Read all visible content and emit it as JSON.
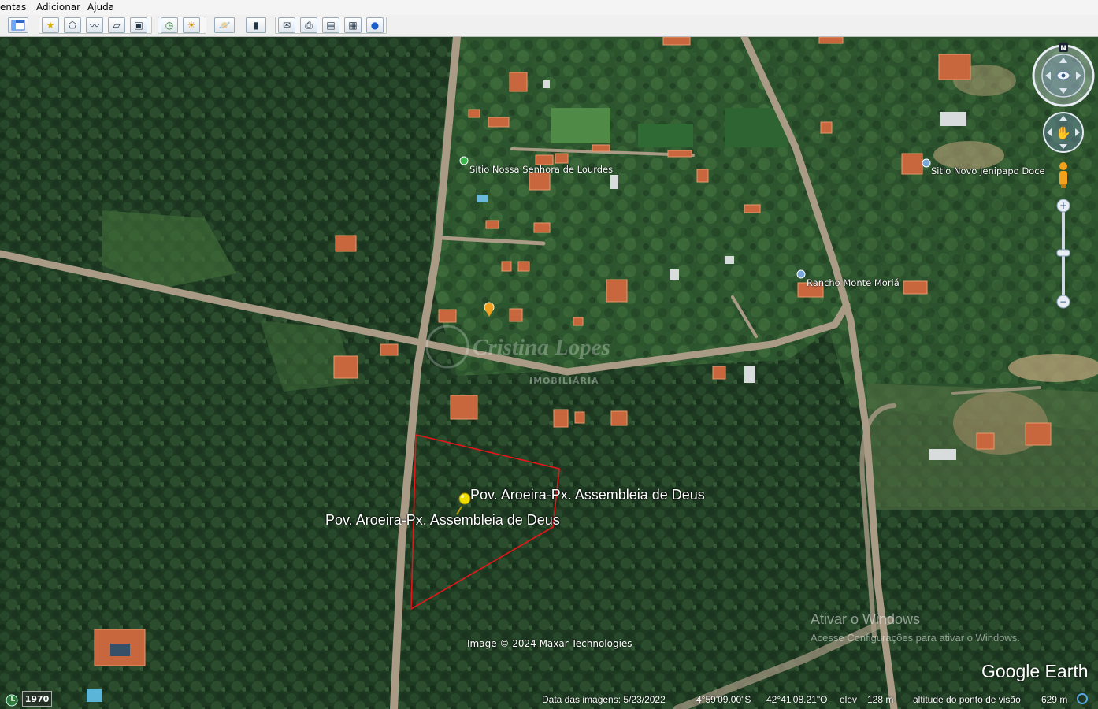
{
  "menu": [
    {
      "label": "entas"
    },
    {
      "label": "Adicionar"
    },
    {
      "label": "Ajuda"
    }
  ],
  "places": [
    {
      "name": "Sítio Nossa Senhora de Lourdes"
    },
    {
      "name": "Sitio Novo Jenipapo Doce"
    },
    {
      "name": "Rancho Monte Moriá"
    }
  ],
  "placemark": {
    "label": "Pov. Aroeira-Px. Assembleia de Deus",
    "polygon_label": "Pov. Aroeira-Px. Assembleia de Deus",
    "color": "#f0e000",
    "outline_color": "#e8141a"
  },
  "watermark": {
    "title": "Cristina Lopes",
    "subtitle": "IMOBILIÁRIA"
  },
  "credit": "Image © 2024 Maxar Technologies",
  "windows_activation": {
    "line1": "Ativar o Windows",
    "line2": "Acesse Configurações para ativar o Windows."
  },
  "logo": "Google Earth",
  "status": {
    "year": "1970",
    "imagery_date": "Data das imagens: 5/23/2022",
    "latitude": "4°59'09.00\"S",
    "longitude": "42°41'08.21\"O",
    "elev_label": "elev",
    "elev_value": "128 m",
    "eye_alt_label": "altitude do ponto de visão",
    "eye_alt_value": "629 m"
  },
  "nav": {
    "north_label": "N"
  }
}
